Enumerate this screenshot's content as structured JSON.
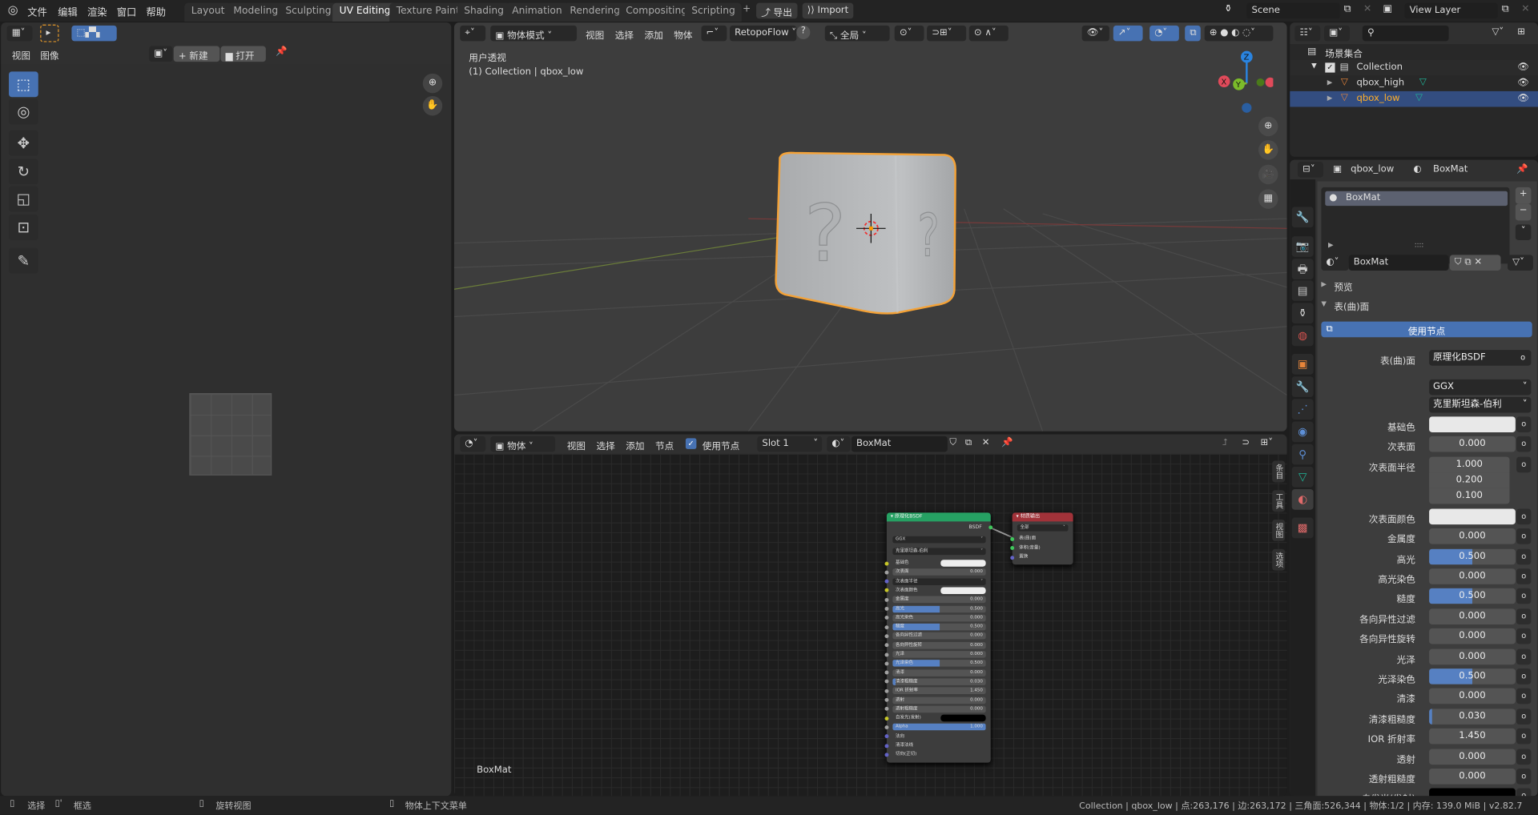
{
  "topbar": {
    "menus": [
      "文件",
      "编辑",
      "渲染",
      "窗口",
      "帮助"
    ],
    "workspaces": [
      "Layout",
      "Modeling",
      "Sculpting",
      "UV Editing",
      "Texture Paint",
      "Shading",
      "Animation",
      "Rendering",
      "Compositing",
      "Scripting"
    ],
    "active_workspace": "UV Editing",
    "export_label": "导出",
    "import_label": "Import",
    "scene": "Scene",
    "view_layer": "View Layer"
  },
  "uv_editor": {
    "menus": [
      "视图",
      "图像"
    ],
    "new_label": "新建",
    "open_label": "打开",
    "tools": [
      "select-box",
      "cursor",
      "move",
      "rotate",
      "scale",
      "transform",
      "annotate"
    ]
  },
  "viewport": {
    "mode": "物体模式",
    "menus": [
      "视图",
      "选择",
      "添加",
      "物体"
    ],
    "addon": "RetopoFlow",
    "orientation": "全局",
    "view_name": "用户透视",
    "collection_info": "(1) Collection | qbox_low",
    "gizmo": {
      "z": "Z",
      "y": "Y",
      "x": "X"
    }
  },
  "node_editor": {
    "mode": "物体",
    "menus": [
      "视图",
      "选择",
      "添加",
      "节点"
    ],
    "use_nodes_label": "使用节点",
    "use_nodes": true,
    "slot": "Slot 1",
    "material": "BoxMat",
    "footer_label": "BoxMat",
    "side_tabs": [
      "条目",
      "工具",
      "视图",
      "选项"
    ],
    "bsdf_node": {
      "title": "原理化BSDF",
      "output": "BSDF",
      "distribution": "GGX",
      "subsurface_method": "克里斯坦森-伯利",
      "rows": [
        {
          "label": "基础色",
          "type": "color",
          "color": "#eeeeee",
          "socket": "#c7c729"
        },
        {
          "label": "次表面",
          "value": "0.000",
          "fill": 0,
          "socket": "#a1a1a1"
        },
        {
          "label": "次表面半径",
          "type": "menu",
          "socket": "#6363c7"
        },
        {
          "label": "次表面颜色",
          "type": "color",
          "color": "#eeeeee",
          "socket": "#c7c729"
        },
        {
          "label": "金属度",
          "value": "0.000",
          "fill": 0,
          "socket": "#a1a1a1"
        },
        {
          "label": "高光",
          "value": "0.500",
          "fill": 0.5,
          "socket": "#a1a1a1"
        },
        {
          "label": "高光染色",
          "value": "0.000",
          "fill": 0,
          "socket": "#a1a1a1"
        },
        {
          "label": "糙度",
          "value": "0.500",
          "fill": 0.5,
          "socket": "#a1a1a1"
        },
        {
          "label": "各向异性过滤",
          "value": "0.000",
          "fill": 0,
          "socket": "#a1a1a1"
        },
        {
          "label": "各向异性旋转",
          "value": "0.000",
          "fill": 0,
          "socket": "#a1a1a1"
        },
        {
          "label": "光泽",
          "value": "0.000",
          "fill": 0,
          "socket": "#a1a1a1"
        },
        {
          "label": "光泽染色",
          "value": "0.500",
          "fill": 0.5,
          "socket": "#a1a1a1"
        },
        {
          "label": "清漆",
          "value": "0.000",
          "fill": 0,
          "socket": "#a1a1a1"
        },
        {
          "label": "清漆粗糙度",
          "value": "0.030",
          "fill": 0.03,
          "socket": "#a1a1a1"
        },
        {
          "label": "IOR 折射率",
          "value": "1.450",
          "fill": 0,
          "socket": "#a1a1a1"
        },
        {
          "label": "透射",
          "value": "0.000",
          "fill": 0,
          "socket": "#a1a1a1"
        },
        {
          "label": "透射粗糙度",
          "value": "0.000",
          "fill": 0,
          "socket": "#a1a1a1"
        },
        {
          "label": "自发光(发射)",
          "type": "color",
          "color": "#000000",
          "socket": "#c7c729"
        },
        {
          "label": "Alpha",
          "value": "1.000",
          "fill": 1,
          "socket": "#a1a1a1"
        },
        {
          "label": "法向",
          "type": "socket",
          "socket": "#6363c7"
        },
        {
          "label": "清漆法线",
          "type": "socket",
          "socket": "#6363c7"
        },
        {
          "label": "切向(正切)",
          "type": "socket",
          "socket": "#6363c7"
        }
      ]
    },
    "output_node": {
      "title": "材质输出",
      "target": "全部",
      "inputs": [
        "表(曲)面",
        "体积(音量)",
        "置换"
      ]
    }
  },
  "outliner": {
    "root": "场景集合",
    "collection": "Collection",
    "items": [
      {
        "name": "qbox_high",
        "selected": false
      },
      {
        "name": "qbox_low",
        "selected": true
      }
    ]
  },
  "properties": {
    "object": "qbox_low",
    "material": "BoxMat",
    "slots": [
      "BoxMat"
    ],
    "material_name": "BoxMat",
    "preview_label": "预览",
    "surface_panel": "表(曲)面",
    "use_nodes_label": "使用节点",
    "surface_label": "表(曲)面",
    "surface_value": "原理化BSDF",
    "distribution": "GGX",
    "subsurface_method": "克里斯坦森-伯利",
    "rows": [
      {
        "label": "基础色",
        "type": "color",
        "color": "#e8e8e8"
      },
      {
        "label": "次表面",
        "value": "0.000",
        "fill": 0
      },
      {
        "label": "次表面半径",
        "type": "vector",
        "values": [
          "1.000",
          "0.200",
          "0.100"
        ]
      },
      {
        "label": "次表面颜色",
        "type": "color",
        "color": "#e8e8e8"
      },
      {
        "label": "金属度",
        "value": "0.000",
        "fill": 0
      },
      {
        "label": "高光",
        "value": "0.500",
        "fill": 0.5
      },
      {
        "label": "高光染色",
        "value": "0.000",
        "fill": 0
      },
      {
        "label": "糙度",
        "value": "0.500",
        "fill": 0.5
      },
      {
        "label": "各向异性过滤",
        "value": "0.000",
        "fill": 0
      },
      {
        "label": "各向异性旋转",
        "value": "0.000",
        "fill": 0
      },
      {
        "label": "光泽",
        "value": "0.000",
        "fill": 0
      },
      {
        "label": "光泽染色",
        "value": "0.500",
        "fill": 0.5
      },
      {
        "label": "清漆",
        "value": "0.000",
        "fill": 0
      },
      {
        "label": "清漆粗糙度",
        "value": "0.030",
        "fill": 0.03
      },
      {
        "label": "IOR 折射率",
        "value": "1.450",
        "fill": 0
      },
      {
        "label": "透射",
        "value": "0.000",
        "fill": 0
      },
      {
        "label": "透射粗糙度",
        "value": "0.000",
        "fill": 0
      },
      {
        "label": "自发光(发射)",
        "type": "color",
        "color": "#000000"
      }
    ],
    "tabs": [
      "tool",
      "render",
      "output",
      "view-layer",
      "scene",
      "world",
      "object",
      "modifiers",
      "particles",
      "physics",
      "constraints",
      "data",
      "material",
      "texture"
    ]
  },
  "statusbar": {
    "hints": [
      "选择",
      "框选",
      "旋转视图",
      "物体上下文菜单"
    ],
    "stats": "Collection | qbox_low | 点:263,176 | 边:263,172 | 三角面:526,344 | 物体:1/2  | 内存: 139.0 MiB | v2.82.7"
  },
  "colors": {
    "accent": "#4772b3",
    "selection": "#ffa030",
    "node_bsdf_header": "#26a163",
    "node_output_header": "#a13239"
  }
}
